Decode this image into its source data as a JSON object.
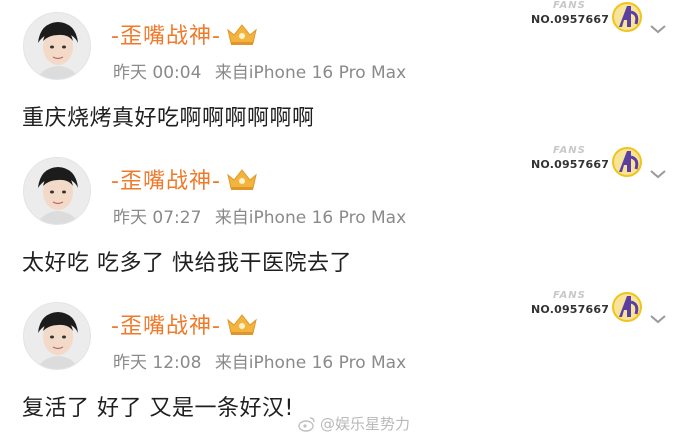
{
  "posts": [
    {
      "username": "-歪嘴战神-",
      "time": "昨天 00:04",
      "source": "来自iPhone 16 Pro Max",
      "text": "重庆烧烤真好吃啊啊啊啊啊啊",
      "fans_label": "FANS",
      "fans_no": "NO.0957667"
    },
    {
      "username": "-歪嘴战神-",
      "time": "昨天 07:27",
      "source": "来自iPhone 16 Pro Max",
      "text": "太好吃 吃多了 快给我干医院去了",
      "fans_label": "FANS",
      "fans_no": "NO.0957667"
    },
    {
      "username": "-歪嘴战神-",
      "time": "昨天 12:08",
      "source": "来自iPhone 16 Pro Max",
      "text": "复活了 好了 又是一条好汉!",
      "fans_label": "FANS",
      "fans_no": "NO.0957667"
    }
  ],
  "watermark": "@娱乐星势力",
  "colors": {
    "username": "#ef7a2a",
    "meta": "#8a8a8a",
    "badge_accent": "#5a3ea0",
    "badge_ring": "#f0c419"
  },
  "icons": {
    "crown": "crown-badge-icon",
    "fans": "avengers-fans-icon",
    "more": "chevron-down-icon",
    "watermark": "weibo-logo-icon"
  }
}
